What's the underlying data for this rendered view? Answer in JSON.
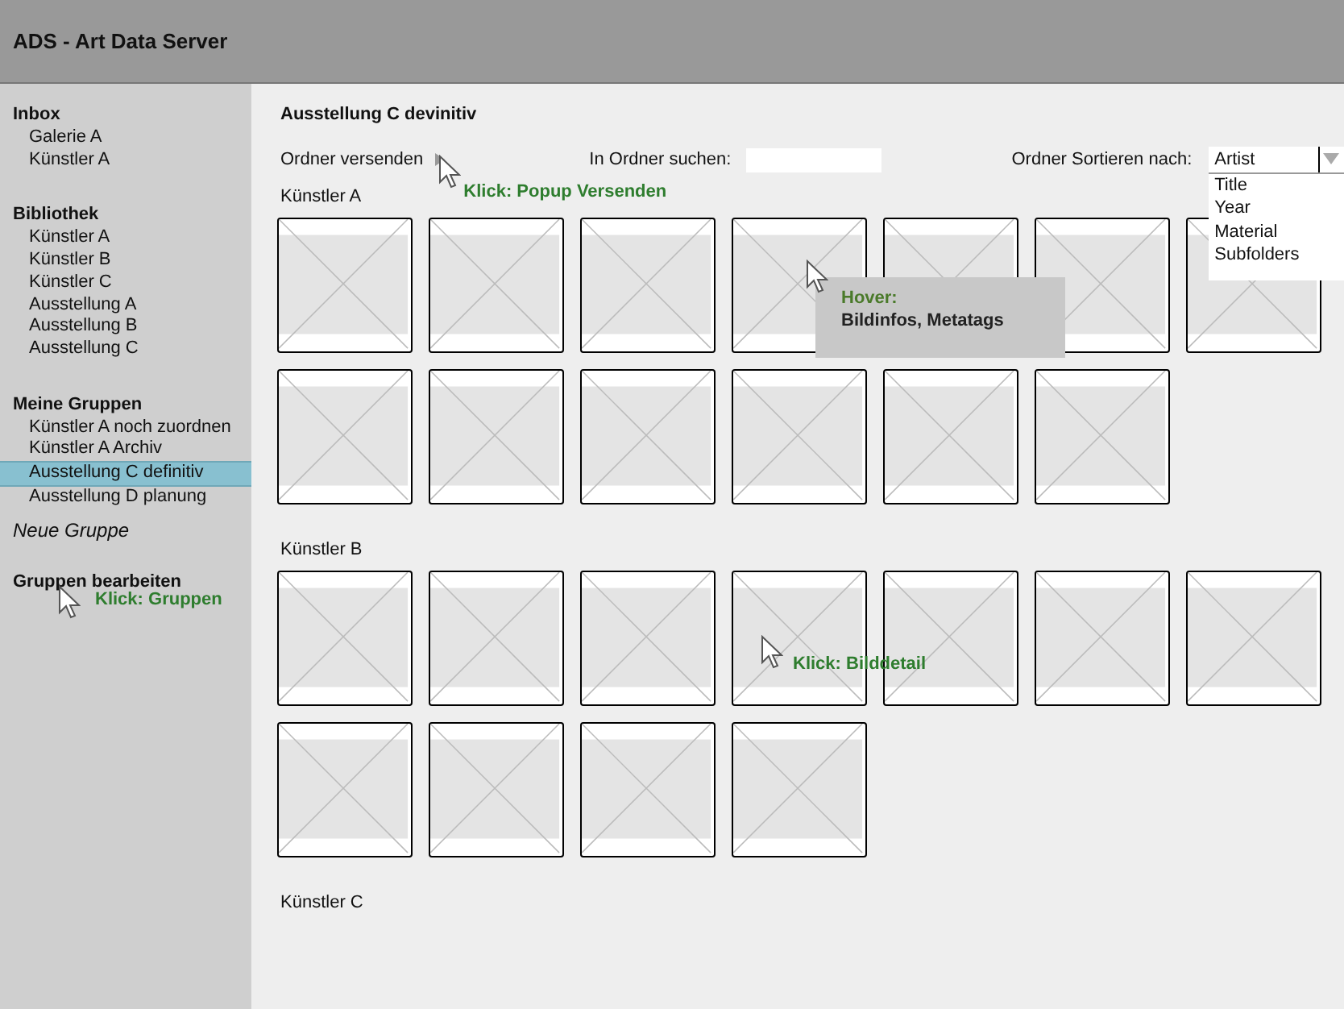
{
  "header": {
    "title": "ADS - Art Data Server"
  },
  "sidebar": {
    "sections": [
      {
        "heading": "Inbox",
        "items": [
          {
            "label": "Galerie A",
            "selected": false
          },
          {
            "label": "Künstler A",
            "selected": false
          }
        ]
      },
      {
        "heading": "Bibliothek",
        "items": [
          {
            "label": "Künstler A",
            "selected": false
          },
          {
            "label": "Künstler B",
            "selected": false
          },
          {
            "label": "Künstler C",
            "selected": false
          },
          {
            "label": "Ausstellung A",
            "selected": false
          },
          {
            "label": "Ausstellung B",
            "selected": false
          },
          {
            "label": "Ausstellung C",
            "selected": false
          }
        ]
      },
      {
        "heading": "Meine Gruppen",
        "items": [
          {
            "label": "Künstler A noch zuordnen",
            "selected": false
          },
          {
            "label": "Künstler A Archiv",
            "selected": false
          },
          {
            "label": "Ausstellung C definitiv",
            "selected": true
          },
          {
            "label": "Ausstellung D planung",
            "selected": false
          }
        ]
      }
    ],
    "actions": [
      {
        "label": "Neue Gruppe",
        "kind": "italic"
      },
      {
        "label": "Gruppen bearbeiten",
        "kind": "bold",
        "note": "Klick: Gruppen"
      }
    ]
  },
  "main": {
    "title": "Ausstellung C devinitiv",
    "toolbar": {
      "send_label": "Ordner versenden",
      "send_note": "Klick: Popup Versenden",
      "search_label": "In Ordner suchen:",
      "sort_label": "Ordner Sortieren nach:",
      "sort_value": "Artist",
      "sort_options": [
        "Title",
        "Year",
        "Material",
        "Subfolders"
      ]
    },
    "sections": [
      {
        "title": "Künstler A",
        "images": [
          {
            "hover": false
          },
          {
            "hover": false
          },
          {
            "hover": false
          },
          {
            "hover": true,
            "tooltip_title": "Hover:",
            "tooltip_text": "Bildinfos, Metatags"
          },
          {
            "hover": false
          },
          {
            "hover": false
          },
          {
            "hover": false
          },
          {
            "hover": false
          },
          {
            "hover": false
          },
          {
            "hover": false
          },
          {
            "hover": false
          },
          {
            "hover": false
          },
          {
            "hover": false
          }
        ]
      },
      {
        "title": "Künstler B",
        "images": [
          {
            "hover": false
          },
          {
            "hover": false
          },
          {
            "hover": false
          },
          {
            "hover": false,
            "note": "Klick: Bilddetail"
          },
          {
            "hover": false
          },
          {
            "hover": false
          },
          {
            "hover": false
          },
          {
            "hover": false
          },
          {
            "hover": false
          },
          {
            "hover": false
          },
          {
            "hover": false
          }
        ]
      },
      {
        "title": "Künstler C"
      }
    ]
  }
}
